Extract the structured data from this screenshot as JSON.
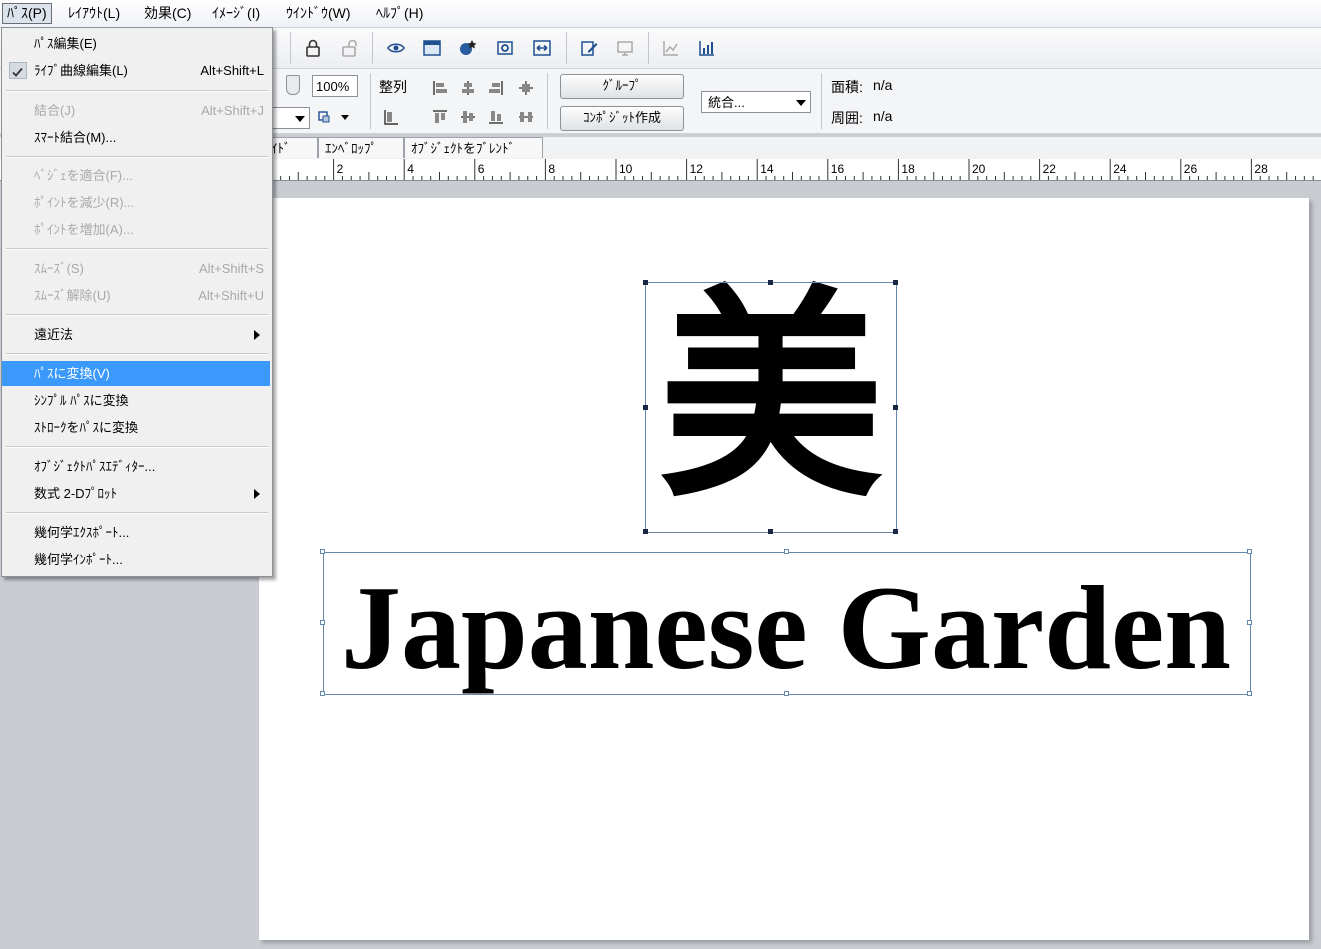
{
  "menubar": {
    "items": [
      "ﾊﾟｽ(P)",
      "ﾚｲｱｳﾄ(L)",
      "効果(C)",
      "ｲﾒｰｼﾞ(I)",
      "ｳｲﾝﾄﾞｳ(W)",
      "ﾍﾙﾌﾟ(H)"
    ]
  },
  "toolbar": {
    "zoom_value": "100%",
    "align_label": "整列",
    "group_button": "ｸﾞﾙｰﾌﾟ",
    "composite_button": "ｺﾝﾎﾟｼﾞｯﾄ作成",
    "combine_select": "統合...",
    "area_label": "面積:",
    "area_value": "n/a",
    "perimeter_label": "周囲:",
    "perimeter_value": "n/a"
  },
  "tabs": [
    "ｲﾄﾞ",
    "ｴﾝﾍﾞﾛｯﾌﾟ",
    "ｵﾌﾞｼﾞｪｸﾄをﾌﾞﾚﾝﾄﾞ"
  ],
  "ruler": {
    "labels": [
      "2",
      "4",
      "6",
      "8",
      "10",
      "12",
      "14",
      "16",
      "18",
      "20",
      "22",
      "24",
      "26",
      "28"
    ]
  },
  "path_menu": {
    "items": [
      {
        "label": "ﾊﾟｽ編集(E)",
        "shortcut": "",
        "disabled": false
      },
      {
        "label": "ﾗｲﾌﾞ曲線編集(L)",
        "shortcut": "Alt+Shift+L",
        "disabled": false,
        "checked": true
      },
      {
        "label": "結合(J)",
        "shortcut": "Alt+Shift+J",
        "disabled": true
      },
      {
        "label": "ｽﾏｰﾄ結合(M)...",
        "shortcut": "",
        "disabled": false
      },
      {
        "label": "ﾍﾞｼﾞｪを適合(F)...",
        "shortcut": "",
        "disabled": true
      },
      {
        "label": "ﾎﾟｲﾝﾄを減少(R)...",
        "shortcut": "",
        "disabled": true
      },
      {
        "label": "ﾎﾟｲﾝﾄを増加(A)...",
        "shortcut": "",
        "disabled": true
      },
      {
        "label": "ｽﾑｰｽﾞ(S)",
        "shortcut": "Alt+Shift+S",
        "disabled": true
      },
      {
        "label": "ｽﾑｰｽﾞ解除(U)",
        "shortcut": "Alt+Shift+U",
        "disabled": true
      },
      {
        "label": "遠近法",
        "shortcut": "",
        "disabled": false,
        "submenu": true
      },
      {
        "label": "ﾊﾟｽに変換(V)",
        "shortcut": "",
        "disabled": false,
        "highlighted": true
      },
      {
        "label": "ｼﾝﾌﾟﾙ ﾊﾟｽに変換",
        "shortcut": "",
        "disabled": false
      },
      {
        "label": "ｽﾄﾛｰｸをﾊﾟｽに変換",
        "shortcut": "",
        "disabled": false
      },
      {
        "label": "ｵﾌﾞｼﾞｪｸﾄﾊﾟｽｴﾃﾞｨﾀｰ...",
        "shortcut": "",
        "disabled": false
      },
      {
        "label": "数式 2-Dﾌﾟﾛｯﾄ",
        "shortcut": "",
        "disabled": false,
        "submenu": true
      },
      {
        "label": "幾何学ｴｸｽﾎﾟｰﾄ...",
        "shortcut": "",
        "disabled": false
      },
      {
        "label": "幾何学ｲﾝﾎﾟｰﾄ...",
        "shortcut": "",
        "disabled": false
      }
    ]
  },
  "canvas": {
    "kanji": "美",
    "title_text": "Japanese Garden"
  },
  "colors": {
    "highlight": "#3b99fc",
    "selection": "#6688aa"
  }
}
